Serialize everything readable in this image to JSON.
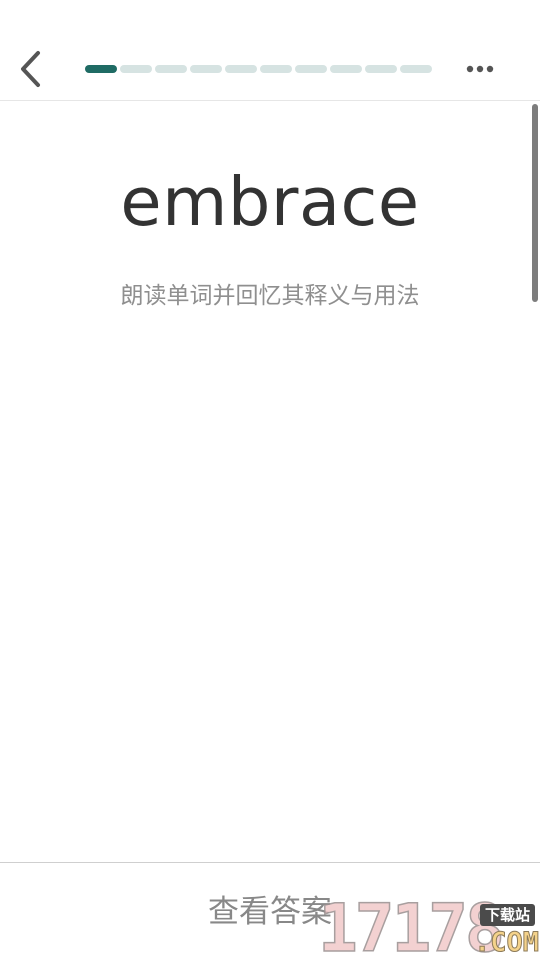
{
  "theme": {
    "accent": "#1f6b64",
    "progress_inactive": "#d6e3e2",
    "scrollbar": "#7d7d7d",
    "icon": "#555555"
  },
  "header": {
    "back_icon": "chevron-left-icon",
    "more_icon": "more-horizontal-icon",
    "progress": {
      "total": 10,
      "current": 1
    }
  },
  "card": {
    "word": "embrace",
    "hint": "朗读单词并回忆其释义与用法"
  },
  "footer": {
    "show_answer_label": "查看答案"
  },
  "watermark": {
    "number": "17178",
    "tag": "下载站",
    "suffix": ".COM"
  }
}
